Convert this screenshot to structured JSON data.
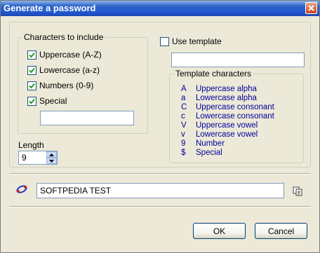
{
  "window": {
    "title": "Generate a password"
  },
  "characters": {
    "group_label": "Characters to include",
    "options": [
      {
        "label": "Uppercase (A-Z)",
        "checked": true
      },
      {
        "label": "Lowercase (a-z)",
        "checked": true
      },
      {
        "label": "Numbers (0-9)",
        "checked": true
      },
      {
        "label": "Special",
        "checked": true
      }
    ],
    "special_value": ""
  },
  "template": {
    "use_label": "Use template",
    "use_checked": false,
    "value": "",
    "group_label": "Template characters",
    "rows": [
      {
        "symbol": "A",
        "desc": "Uppercase alpha"
      },
      {
        "symbol": "a",
        "desc": "Lowercase alpha"
      },
      {
        "symbol": "C",
        "desc": "Uppercase consonant"
      },
      {
        "symbol": "c",
        "desc": "Lowercase consonant"
      },
      {
        "symbol": "V",
        "desc": "Uppercase vowel"
      },
      {
        "symbol": "v",
        "desc": "Lowercase vowel"
      },
      {
        "symbol": "9",
        "desc": "Number"
      },
      {
        "symbol": "$",
        "desc": "Special"
      }
    ]
  },
  "length": {
    "label": "Length",
    "value": "9"
  },
  "password": {
    "value": "SOFTPEDIA TEST"
  },
  "buttons": {
    "ok": "OK",
    "cancel": "Cancel"
  },
  "icons": {
    "generate": "generate-icon",
    "copy": "copy-icon"
  }
}
